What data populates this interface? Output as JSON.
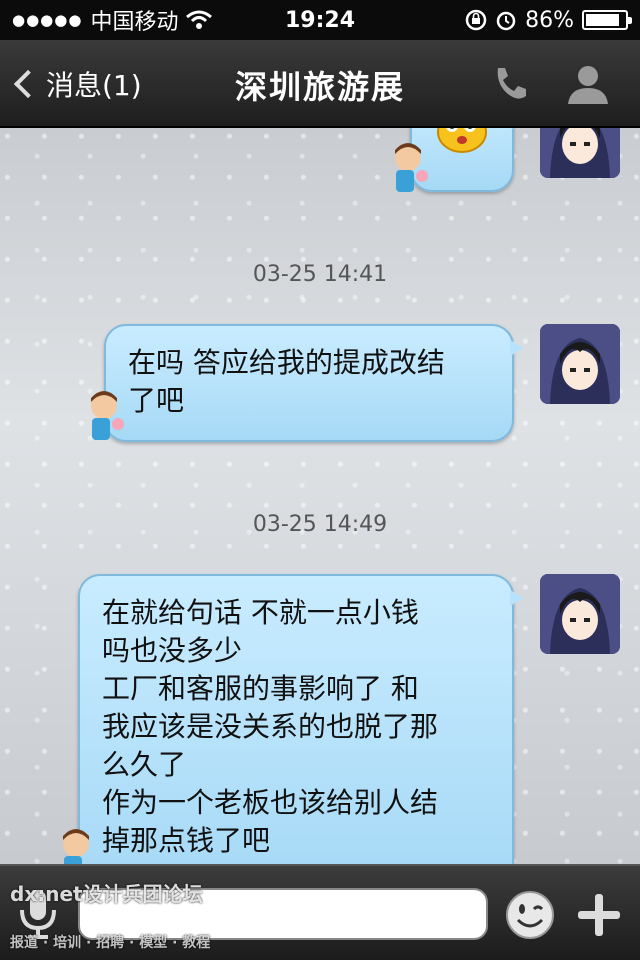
{
  "status_bar": {
    "carrier": "中国移动",
    "time": "19:24",
    "battery_percent": "86%",
    "battery_level": 0.86,
    "icons": [
      "signal-icon",
      "wifi-icon",
      "rotation-lock-icon",
      "alarm-icon",
      "battery-icon"
    ]
  },
  "nav": {
    "back_label": "消息(1)",
    "title": "深圳旅游展",
    "icons": [
      "back-chevron-icon",
      "phone-icon",
      "contact-icon"
    ]
  },
  "messages": [
    {
      "type": "sticker",
      "sender": "self"
    },
    {
      "type": "timestamp",
      "text": "03-25 14:41"
    },
    {
      "type": "text",
      "sender": "self",
      "text": "在吗 答应给我的提成改结\n了吧"
    },
    {
      "type": "timestamp",
      "text": "03-25 14:49"
    },
    {
      "type": "text",
      "sender": "self",
      "text": "在就给句话 不就一点小钱\n吗也没多少\n工厂和客服的事影响了 和\n我应该是没关系的也脱了那\n么久了\n作为一个老板也该给别人结\n掉那点钱了吧"
    }
  ],
  "input_bar": {
    "placeholder": "",
    "icons": [
      "microphone-icon",
      "emoji-icon",
      "plus-icon"
    ]
  },
  "watermark": {
    "main": "dx:net设计兵团论坛",
    "sub": "报道 · 培训 · 招聘 · 模型 · 教程"
  },
  "colors": {
    "bubble": "#b7e2fb",
    "bubble_border": "#7fb9dd",
    "nav_bg": "#2a2a2a"
  }
}
